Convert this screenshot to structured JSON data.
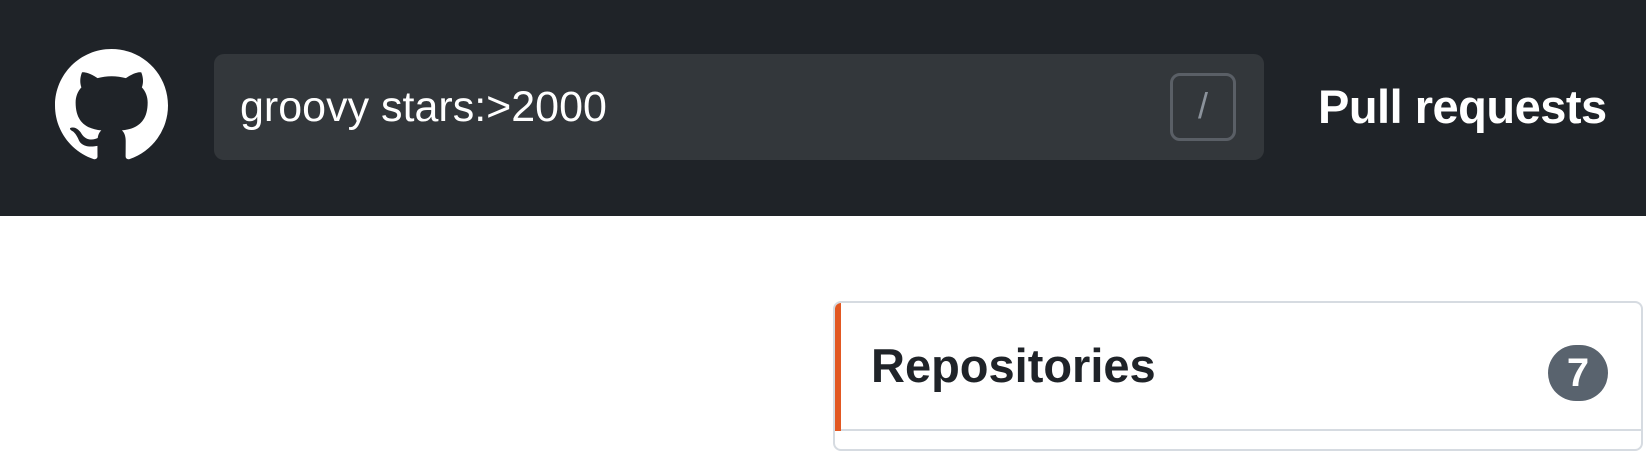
{
  "header": {
    "logo_icon": "github-mark-icon",
    "search": {
      "value": "groovy stars:>2000",
      "shortcut_key": "/"
    },
    "nav": {
      "pull_requests_label": "Pull requests"
    }
  },
  "sidebar_filter": {
    "items": [
      {
        "label": "Repositories",
        "count": "7",
        "selected": true
      }
    ]
  },
  "colors": {
    "header_background": "#1f2328",
    "search_background": "#33373b",
    "selected_accent": "#e25822",
    "badge_background": "#59636e"
  }
}
